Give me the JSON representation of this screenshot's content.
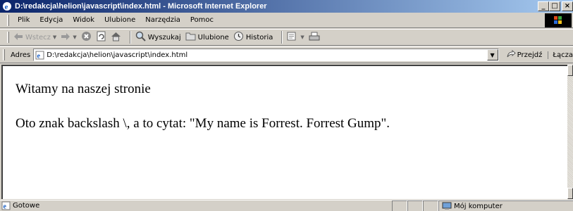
{
  "window": {
    "title": "D:\\redakcja\\helion\\javascript\\index.html - Microsoft Internet Explorer",
    "minimize": "_",
    "maximize": "□",
    "close": "×"
  },
  "menu": {
    "items": [
      "Plik",
      "Edycja",
      "Widok",
      "Ulubione",
      "Narzędzia",
      "Pomoc"
    ]
  },
  "toolbar": {
    "back_label": "Wstecz",
    "search_label": "Wyszukaj",
    "favorites_label": "Ulubione",
    "history_label": "Historia"
  },
  "address": {
    "label": "Adres",
    "value": "D:\\redakcja\\helion\\javascript\\index.html",
    "go_label": "Przejdź",
    "links_label": "Łącza"
  },
  "content": {
    "line1": "Witamy na naszej stronie",
    "line2": "Oto znak backslash \\, a to cytat: \"My name is Forrest. Forrest Gump\"."
  },
  "status": {
    "text": "Gotowe",
    "zone": "Mój komputer"
  },
  "colors": {
    "titlebar_start": "#0a246a",
    "titlebar_end": "#a6caf0",
    "chrome": "#d4d0c8"
  }
}
